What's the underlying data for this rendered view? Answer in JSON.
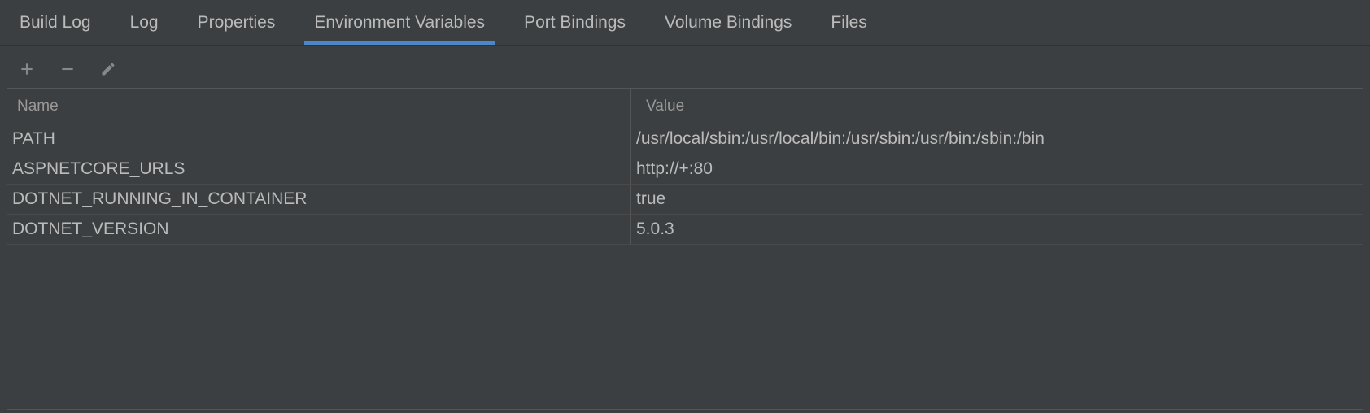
{
  "tabs": [
    {
      "label": "Build Log"
    },
    {
      "label": "Log"
    },
    {
      "label": "Properties"
    },
    {
      "label": "Environment Variables"
    },
    {
      "label": "Port Bindings"
    },
    {
      "label": "Volume Bindings"
    },
    {
      "label": "Files"
    }
  ],
  "table": {
    "columns": {
      "name": "Name",
      "value": "Value"
    },
    "rows": [
      {
        "name": "PATH",
        "value": "/usr/local/sbin:/usr/local/bin:/usr/sbin:/usr/bin:/sbin:/bin"
      },
      {
        "name": "ASPNETCORE_URLS",
        "value": "http://+:80"
      },
      {
        "name": "DOTNET_RUNNING_IN_CONTAINER",
        "value": "true"
      },
      {
        "name": "DOTNET_VERSION",
        "value": "5.0.3"
      }
    ]
  }
}
